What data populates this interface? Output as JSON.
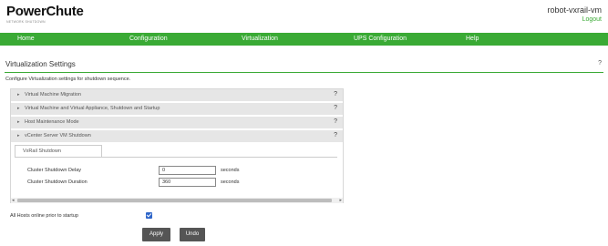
{
  "header": {
    "logo": "PowerChute",
    "logo_sub": "NETWORK SHUTDOWN",
    "hostname": "robot-vxrail-vm",
    "logout": "Logout"
  },
  "nav": {
    "items": [
      {
        "label": "Home"
      },
      {
        "label": "Configuration"
      },
      {
        "label": "Virtualization"
      },
      {
        "label": "UPS Configuration"
      },
      {
        "label": "Help"
      }
    ],
    "color": "#3aaa35"
  },
  "page": {
    "title": "Virtualization Settings",
    "help": "?",
    "description": "Configure Virtualization settings for shutdown sequence."
  },
  "accordion": {
    "items": [
      {
        "label": "Virtual Machine Migration",
        "help": "?"
      },
      {
        "label": "Virtual Machine and Virtual Appliance, Shutdown and Startup",
        "help": "?"
      },
      {
        "label": "Host Maintenance Mode",
        "help": "?"
      },
      {
        "label": "vCenter Server VM Shutdown",
        "help": "?"
      }
    ],
    "arrow": "▸"
  },
  "vxrail": {
    "tab_label": "VxRail Shutdown",
    "fields": [
      {
        "label": "Cluster Shutdown Delay",
        "value": "0",
        "unit": "seconds"
      },
      {
        "label": "Cluster Shutdown Duration",
        "value": "360",
        "unit": "seconds"
      }
    ]
  },
  "scroll": {
    "left_icon": "◂",
    "right_icon": "▸"
  },
  "options": {
    "all_hosts_online_label": "All Hosts online prior to startup",
    "all_hosts_online_checked": true
  },
  "buttons": {
    "apply": "Apply",
    "undo": "Undo"
  }
}
